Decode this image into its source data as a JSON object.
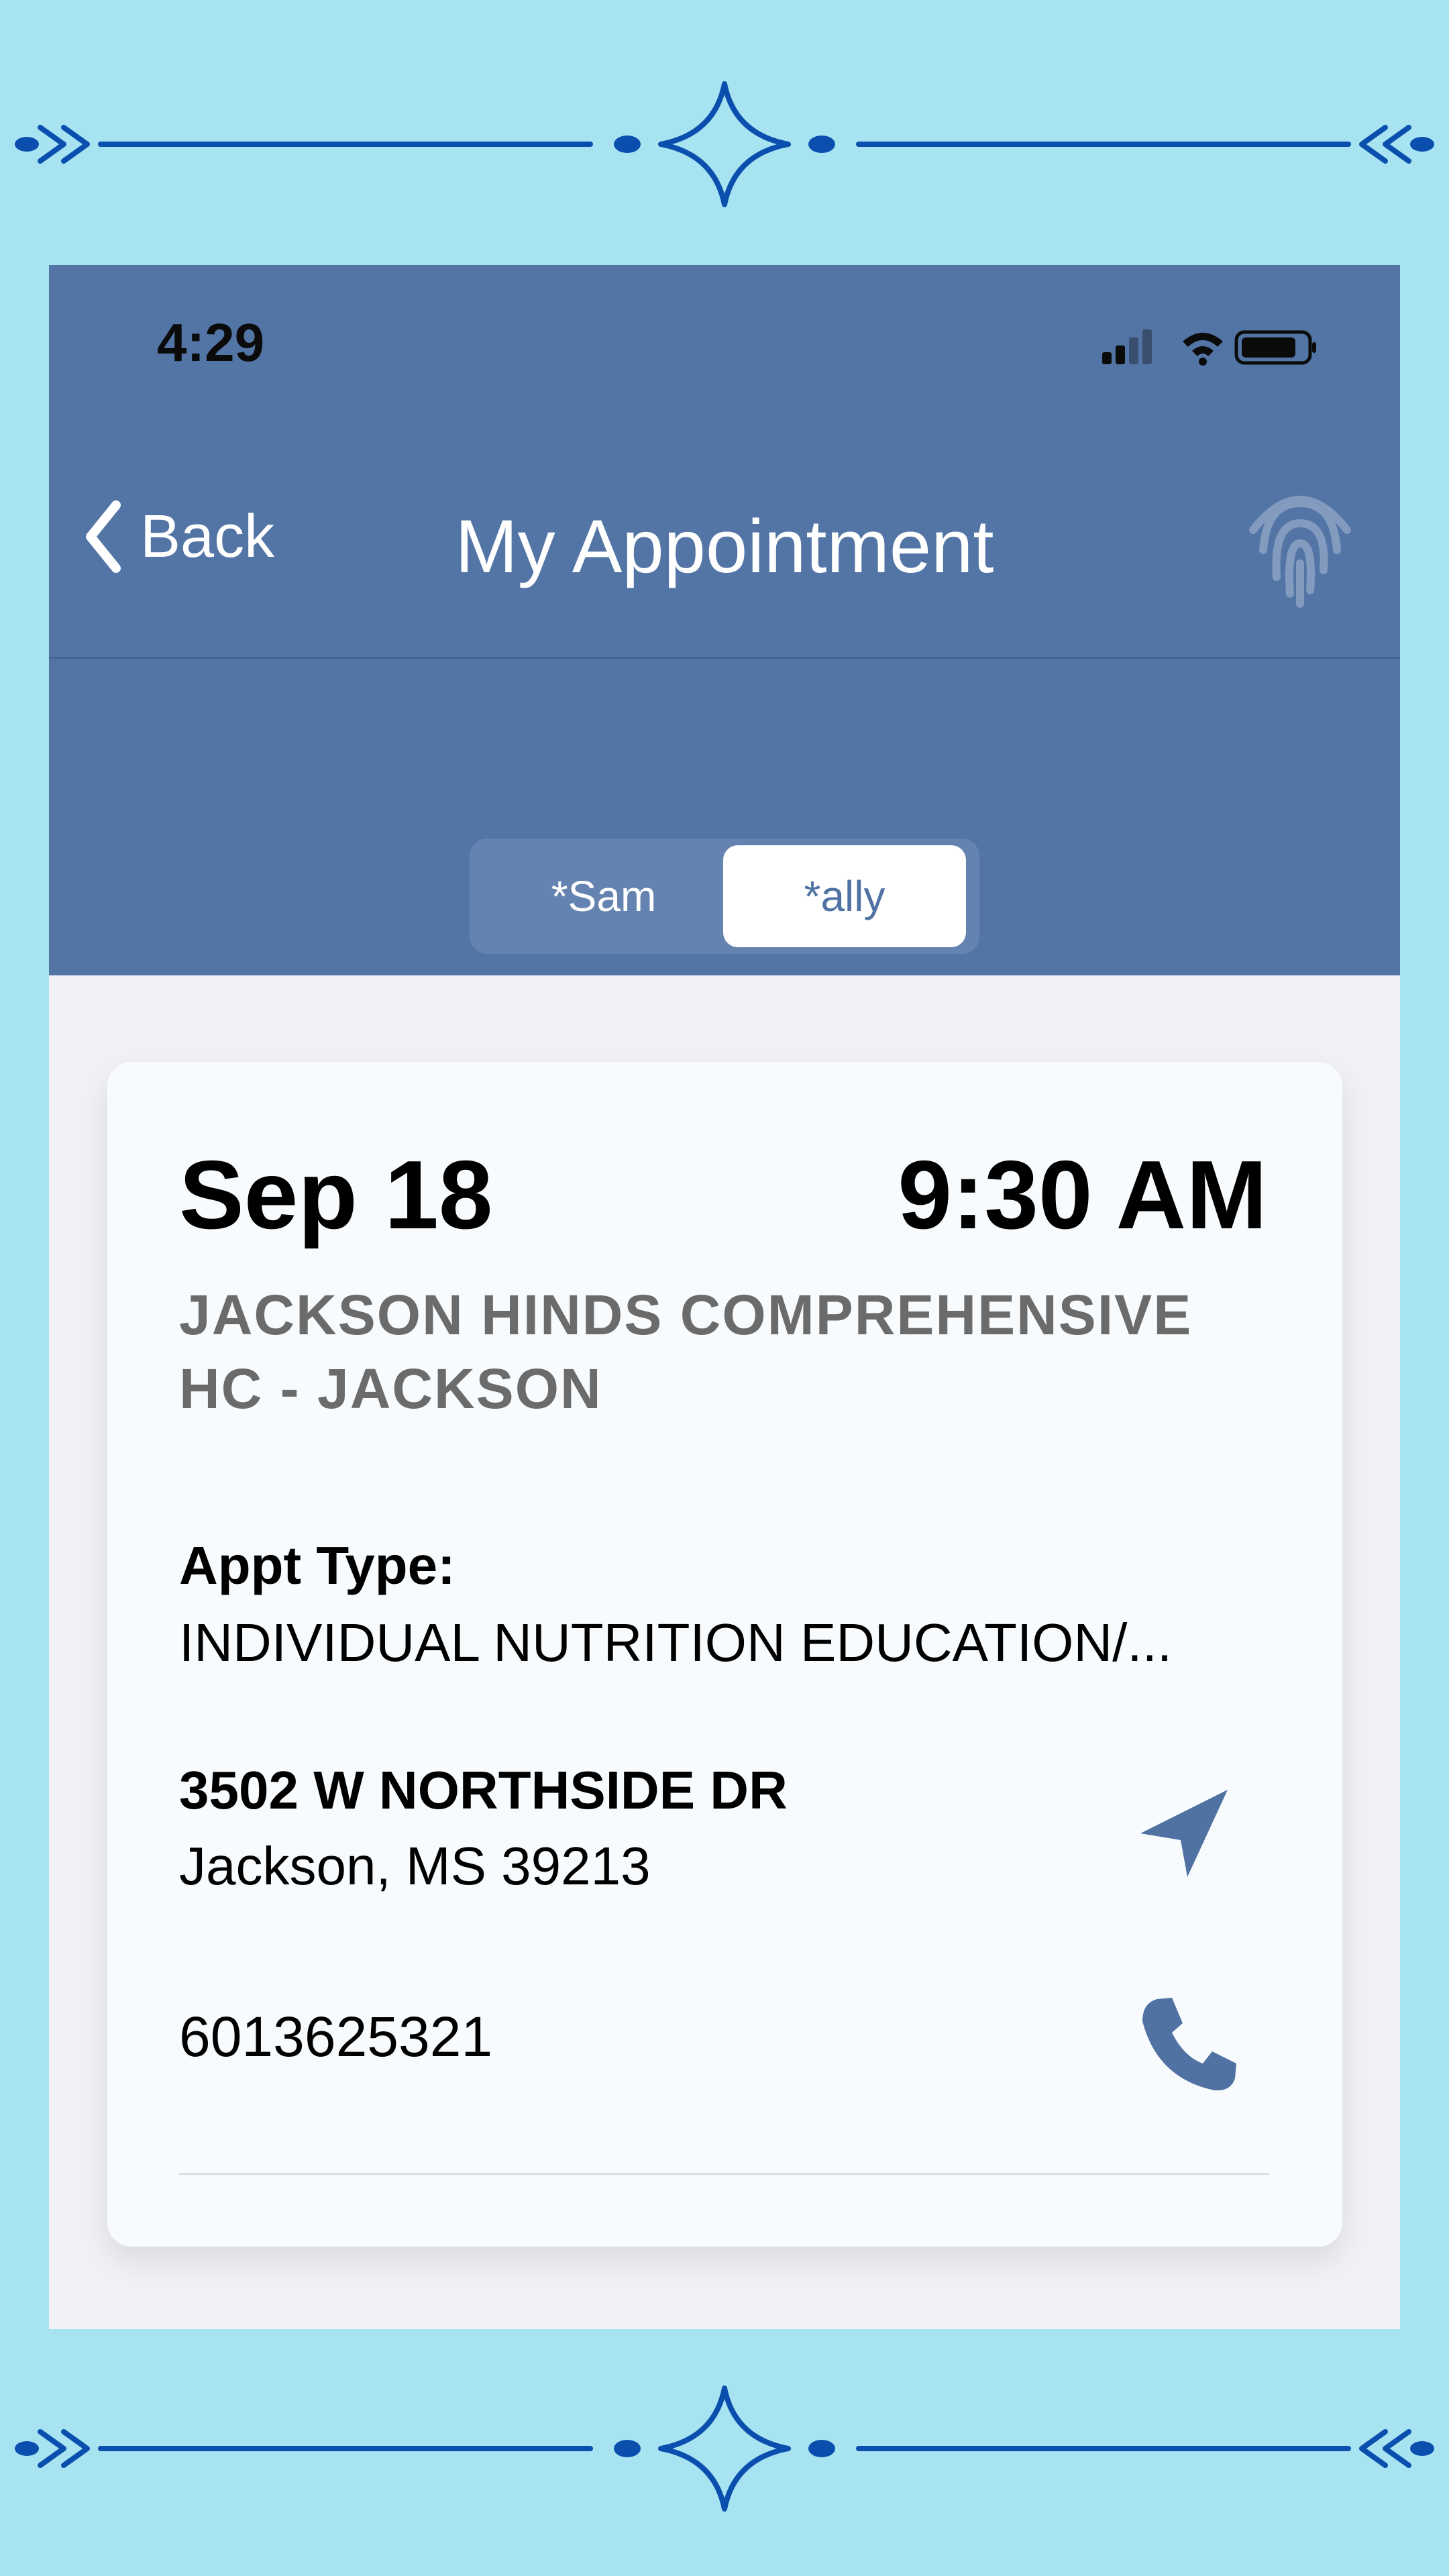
{
  "status_bar": {
    "time": "4:29"
  },
  "nav": {
    "back_label": "Back",
    "title": "My Appointment"
  },
  "segments": {
    "left": "*Sam",
    "right": "*ally",
    "selected": "*ally"
  },
  "appointment": {
    "date": "Sep 18",
    "time": "9:30 AM",
    "clinic": "JACKSON HINDS COMPREHENSIVE HC - JACKSON",
    "appt_type_label": "Appt Type:",
    "appt_type_value": "INDIVIDUAL NUTRITION EDUCATION/...",
    "address_line1": "3502 W NORTHSIDE DR",
    "address_line2": "Jackson, MS 39213",
    "phone": "6013625321"
  },
  "icons": {
    "back": "chevron-left-icon",
    "biometric": "fingerprint-icon",
    "directions": "location-arrow-icon",
    "call": "phone-icon"
  },
  "colors": {
    "background": "#a8e3f2",
    "header": "#5275a6",
    "accent": "#4f72a3",
    "ornament": "#0a4fae"
  }
}
